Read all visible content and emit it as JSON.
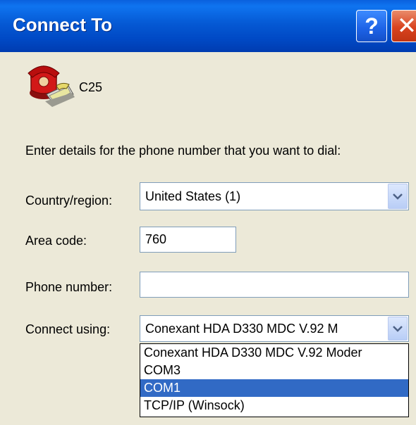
{
  "window": {
    "title": "Connect To"
  },
  "connection": {
    "name": "C25"
  },
  "instructions": "Enter details for the phone number that you want to dial:",
  "country": {
    "label": "Country/region:",
    "value": "United States (1)"
  },
  "area_code": {
    "label": "Area code:",
    "value": "760"
  },
  "phone_number": {
    "label": "Phone number:",
    "value": ""
  },
  "connect_using": {
    "label": "Connect using:",
    "value": "Conexant HDA D330 MDC V.92 M",
    "options": [
      {
        "label": "Conexant HDA D330 MDC V.92 Moder",
        "selected": false
      },
      {
        "label": "COM3",
        "selected": false
      },
      {
        "label": "COM1",
        "selected": true
      },
      {
        "label": "TCP/IP (Winsock)",
        "selected": false
      }
    ]
  },
  "colors": {
    "titlebar": "#0055e5",
    "client": "#ece9d8",
    "selection": "#316ac5"
  }
}
